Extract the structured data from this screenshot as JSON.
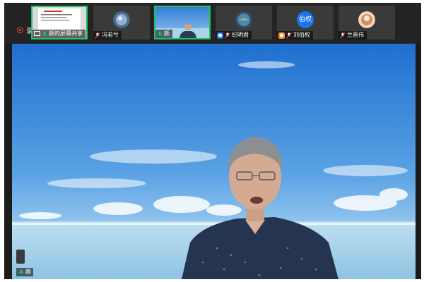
{
  "recording": {
    "label": "录制中"
  },
  "colors": {
    "active_border": "#23c16b",
    "record_red": "#e84c3d",
    "avatar_blue": "#1a73e8",
    "user_badge_blue": "#1a73e8",
    "user_badge_orange": "#f08a24"
  },
  "participants": [
    {
      "name": "颜的屏幕共享",
      "kind": "screen-share",
      "mic": "on",
      "active": true
    },
    {
      "name": "冯若兮",
      "kind": "avatar",
      "mic": "muted",
      "active": false
    },
    {
      "name": "颜",
      "kind": "video",
      "mic": "on",
      "active": true
    },
    {
      "name": "纪明君",
      "kind": "avatar",
      "mic": "muted",
      "badge": "user",
      "active": false
    },
    {
      "name": "刘伯权",
      "kind": "avatar-text",
      "avatar_text": "伯权",
      "mic": "muted",
      "badge": "user",
      "active": false
    },
    {
      "name": "兰晋伟",
      "kind": "avatar",
      "mic": "muted",
      "active": false
    }
  ],
  "main_view": {
    "speaker_label": "颜"
  }
}
